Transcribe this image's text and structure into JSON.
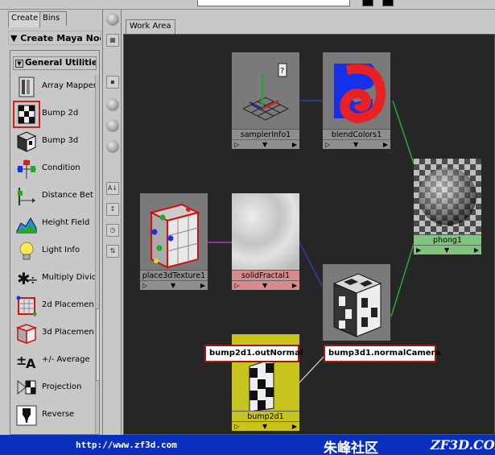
{
  "tabs": {
    "create": "Create",
    "bins": "Bins"
  },
  "create_header": "Create Maya Nodes",
  "section_title": "General Utilities",
  "node_list": [
    {
      "label": "Array Mapper",
      "icon": "array-mapper-icon"
    },
    {
      "label": "Bump 2d",
      "icon": "bump2d-icon",
      "selected": true
    },
    {
      "label": "Bump 3d",
      "icon": "bump3d-icon"
    },
    {
      "label": "Condition",
      "icon": "condition-icon"
    },
    {
      "label": "Distance Bet",
      "icon": "distance-between-icon"
    },
    {
      "label": "Height Field",
      "icon": "height-field-icon"
    },
    {
      "label": "Light Info",
      "icon": "light-info-icon"
    },
    {
      "label": "Multiply Divid",
      "icon": "multiply-divide-icon"
    },
    {
      "label": "2d Placemen",
      "icon": "place2d-icon"
    },
    {
      "label": "3d Placemen",
      "icon": "place3d-icon"
    },
    {
      "label": "+/- Average",
      "icon": "plus-minus-average-icon"
    },
    {
      "label": "Projection",
      "icon": "projection-icon"
    },
    {
      "label": "Reverse",
      "icon": "reverse-icon"
    }
  ],
  "work_area_tab": "Work Area",
  "graph_nodes": {
    "samplerInfo": "samplerInfo1",
    "blendColors": "blendColors1",
    "phong": "phong1",
    "place3dTexture": "place3dTexture1",
    "solidFractal": "solidFractal1",
    "bump3d": "bump3d1",
    "bump2d": "bump2d1"
  },
  "connection_labels": {
    "bump2d_out": "bump2d1.outNormal",
    "bump3d_in": "bump3d1.normalCamera"
  },
  "colors": {
    "work_bg": "#262626",
    "solid_fractal_tint": "#d98a8a",
    "phong_tint": "#7fc47f",
    "bump2d_tint": "#c8c41e",
    "selection_red": "#cc2222",
    "footer_blue": "#0a2fbf"
  },
  "footer": {
    "url": "http://www.zf3d.com",
    "brand_cn": "朱峰社区",
    "brand_en": "ZF3D.COM"
  }
}
